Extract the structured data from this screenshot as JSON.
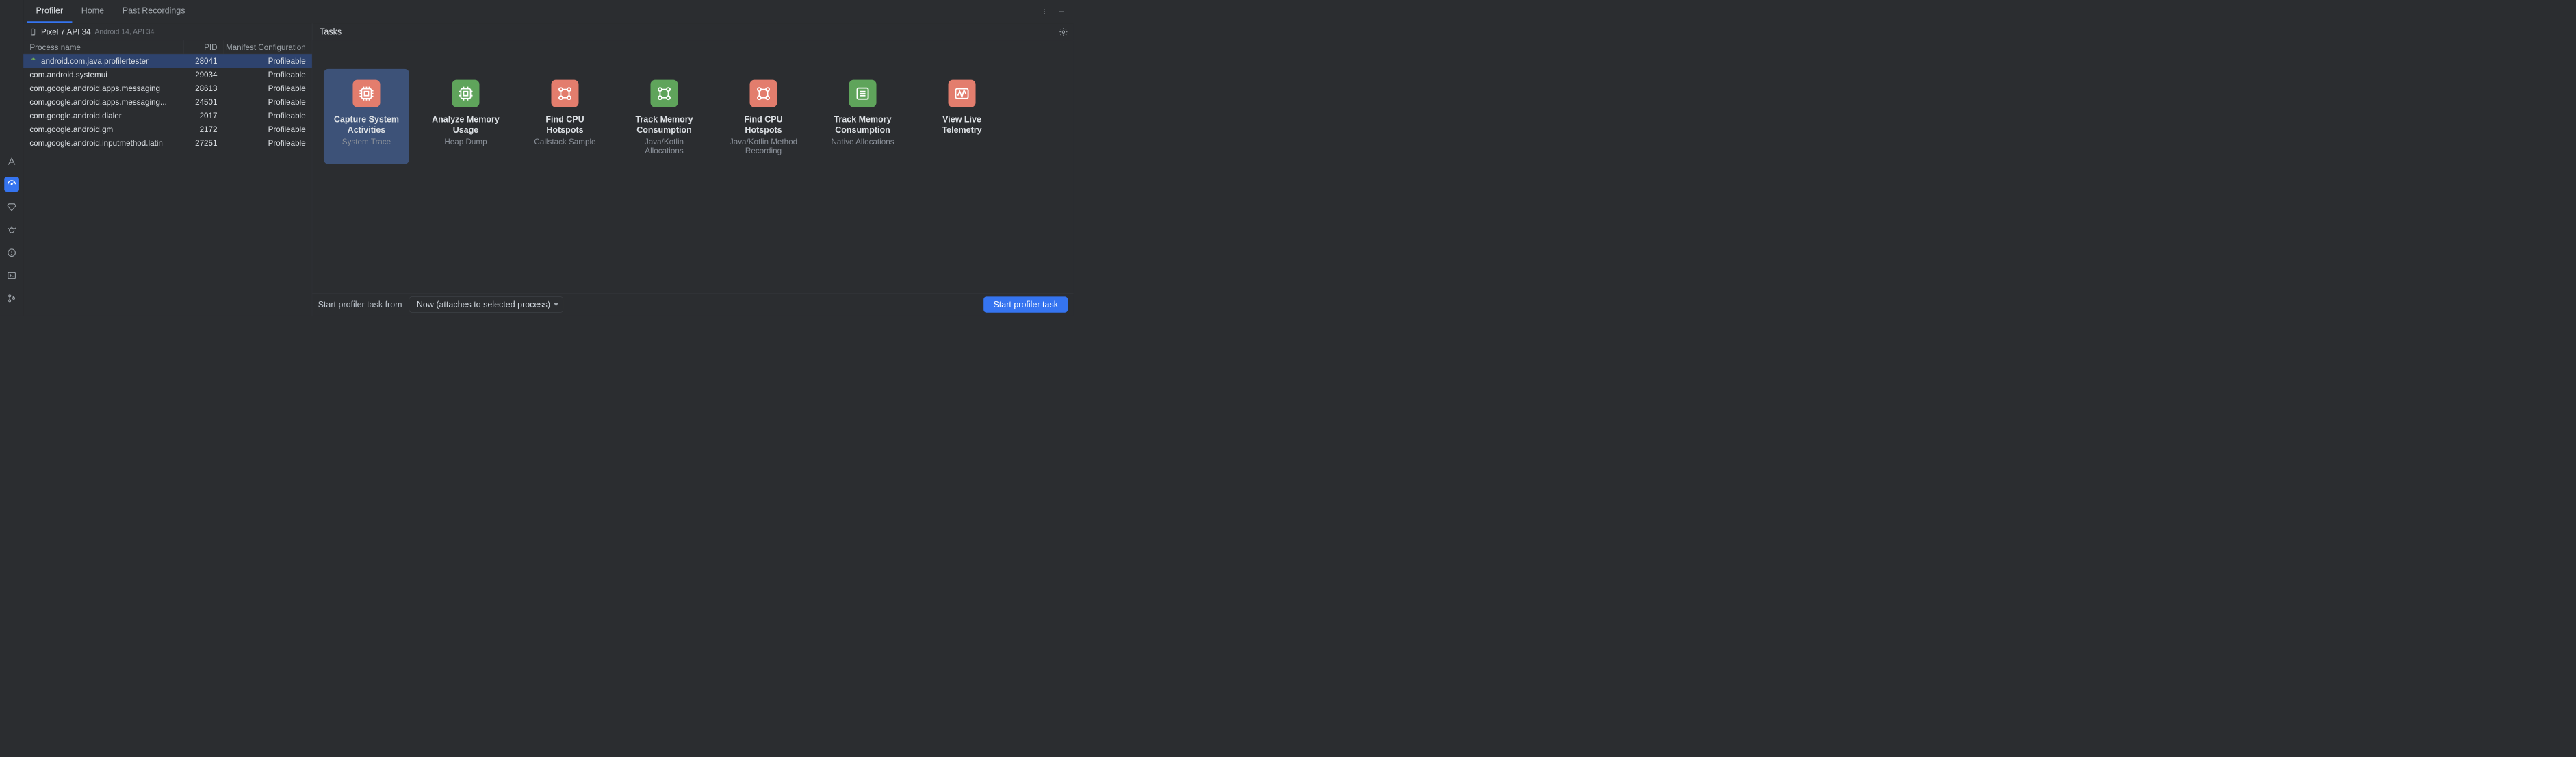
{
  "tabs": [
    "Profiler",
    "Home",
    "Past Recordings"
  ],
  "active_tab": 0,
  "device": {
    "name": "Pixel 7 API 34",
    "api": "Android 14, API 34"
  },
  "tasks_label": "Tasks",
  "columns": {
    "name": "Process name",
    "pid": "PID",
    "manifest": "Manifest Configuration"
  },
  "processes": [
    {
      "name": "android.com.java.profilertester",
      "pid": "28041",
      "manifest": "Profileable",
      "selected": true
    },
    {
      "name": "com.android.systemui",
      "pid": "29034",
      "manifest": "Profileable"
    },
    {
      "name": "com.google.android.apps.messaging",
      "pid": "28613",
      "manifest": "Profileable"
    },
    {
      "name": "com.google.android.apps.messaging...",
      "pid": "24501",
      "manifest": "Profileable"
    },
    {
      "name": "com.google.android.dialer",
      "pid": "2017",
      "manifest": "Profileable"
    },
    {
      "name": "com.google.android.gm",
      "pid": "2172",
      "manifest": "Profileable"
    },
    {
      "name": "com.google.android.inputmethod.latin",
      "pid": "27251",
      "manifest": "Profileable"
    }
  ],
  "tasks": [
    {
      "title": "Capture System Activities",
      "sub": "System Trace",
      "icon": "cpu",
      "color": "coral",
      "selected": true
    },
    {
      "title": "Analyze Memory Usage",
      "sub": "Heap Dump",
      "icon": "chip",
      "color": "green"
    },
    {
      "title": "Find CPU Hotspots",
      "sub": "Callstack Sample",
      "icon": "tree",
      "color": "coral"
    },
    {
      "title": "Track Memory Consumption",
      "sub": "Java/Kotlin Allocations",
      "icon": "tree",
      "color": "green"
    },
    {
      "title": "Find CPU Hotspots",
      "sub": "Java/Kotlin Method Recording",
      "icon": "tree",
      "color": "coral"
    },
    {
      "title": "Track Memory Consumption",
      "sub": "Native Allocations",
      "icon": "list",
      "color": "green"
    },
    {
      "title": "View Live Telemetry",
      "sub": "",
      "icon": "wave",
      "color": "coral"
    }
  ],
  "footer": {
    "label": "Start profiler task from",
    "dropdown": "Now (attaches to selected process)",
    "button": "Start profiler task"
  },
  "rail_icons": [
    "triangle",
    "profiler",
    "diamond",
    "bug",
    "warning",
    "terminal",
    "git"
  ]
}
